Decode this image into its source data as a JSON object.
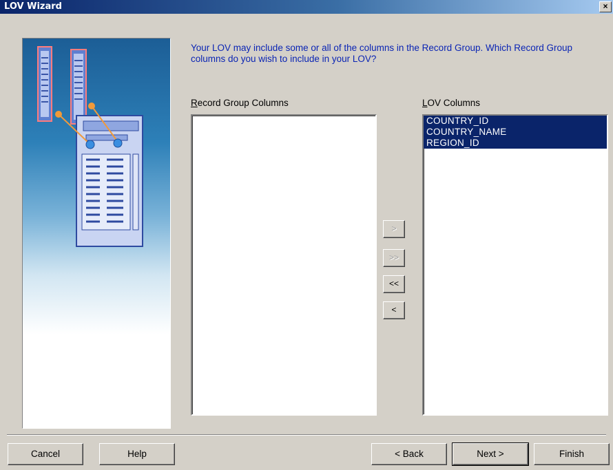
{
  "window": {
    "title": "LOV Wizard",
    "close_glyph": "×"
  },
  "prompt": "Your LOV may include some or all of the columns in the Record Group. Which Record Group columns do you wish to include in your LOV?",
  "record_group": {
    "label": "ecord Group Columns",
    "accel": "R",
    "items": []
  },
  "lov_columns": {
    "label": "OV Columns",
    "accel": "L",
    "items": [
      "COUNTRY_ID",
      "COUNTRY_NAME",
      "REGION_ID"
    ]
  },
  "move_buttons": {
    "add": ">",
    "add_all": ">>",
    "remove_all": "<<",
    "remove": "<"
  },
  "footer": {
    "cancel": "Cancel",
    "help": "Help",
    "back": "< Back",
    "next": "Next >",
    "finish": "Finish"
  }
}
